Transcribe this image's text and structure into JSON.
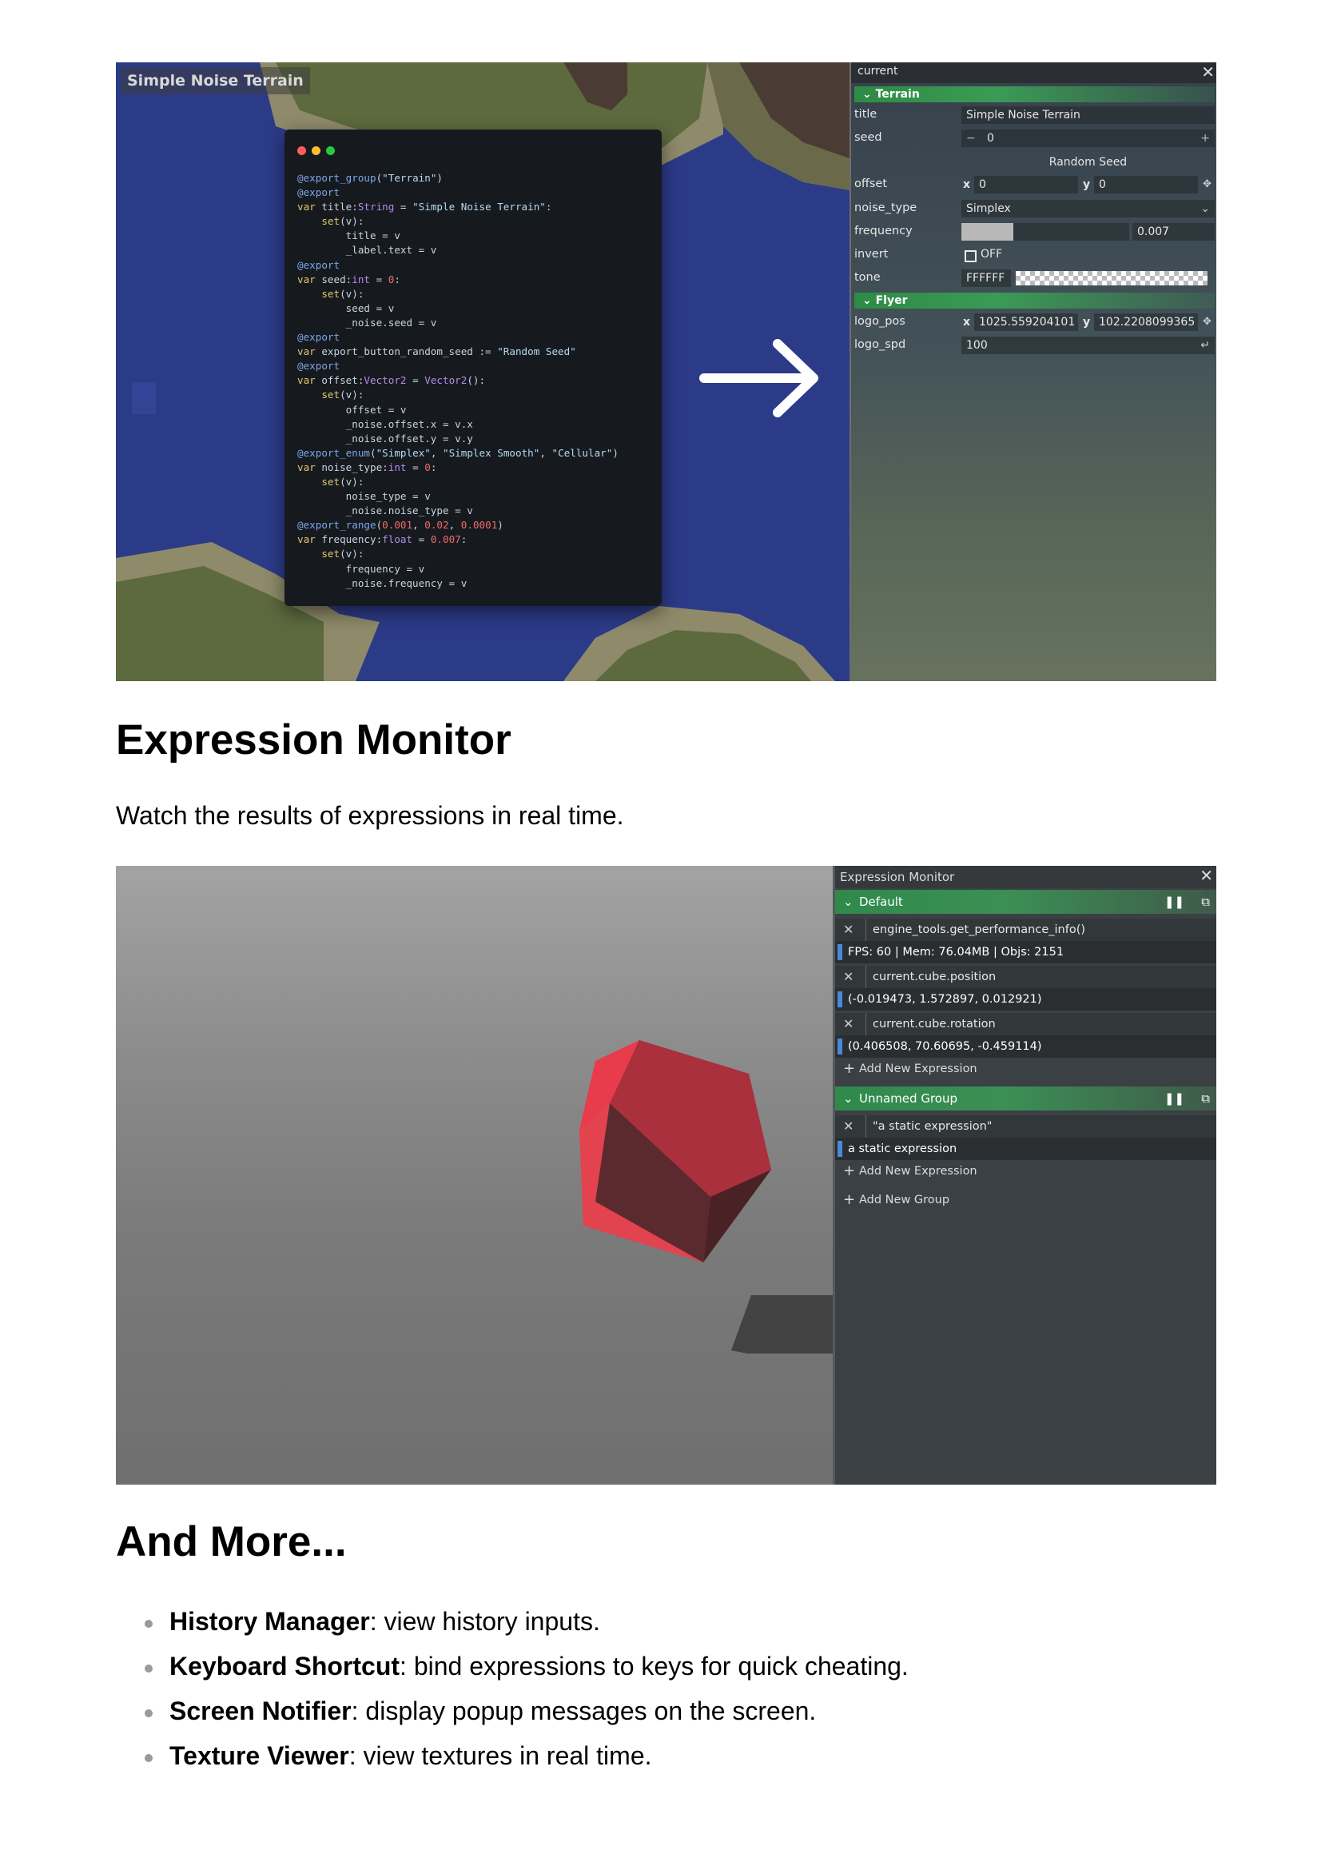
{
  "screenshot1": {
    "game_title": "Simple Noise Terrain",
    "code_lines": [
      "@export_group(\"Terrain\")",
      "@export",
      "var title:String = \"Simple Noise Terrain\":",
      "    set(v):",
      "        title = v",
      "        _label.text = v",
      "@export",
      "var seed:int = 0:",
      "    set(v):",
      "        seed = v",
      "        _noise.seed = v",
      "@export",
      "var export_button_random_seed := \"Random Seed\"",
      "@export",
      "var offset:Vector2 = Vector2():",
      "    set(v):",
      "        offset = v",
      "        _noise.offset.x = v.x",
      "        _noise.offset.y = v.y",
      "@export_enum(\"Simplex\", \"Simplex Smooth\", \"Cellular\")",
      "var noise_type:int = 0:",
      "    set(v):",
      "        noise_type = v",
      "        _noise.noise_type = v",
      "@export_range(0.001, 0.02, 0.0001)",
      "var frequency:float = 0.007:",
      "    set(v):",
      "        frequency = v",
      "        _noise.frequency = v"
    ],
    "inspector": {
      "header": "current",
      "terrain_group": "Terrain",
      "title_label": "title",
      "title_value": "Simple Noise Terrain",
      "seed_label": "seed",
      "seed_value": "0",
      "random_seed_button": "Random Seed",
      "offset_label": "offset",
      "offset_x_label": "x",
      "offset_x": "0",
      "offset_y_label": "y",
      "offset_y": "0",
      "noise_type_label": "noise_type",
      "noise_type_value": "Simplex",
      "frequency_label": "frequency",
      "frequency_value": "0.007",
      "frequency_fraction": 0.31,
      "invert_label": "invert",
      "invert_value": "OFF",
      "tone_label": "tone",
      "tone_value": "FFFFFF",
      "flyer_group": "Flyer",
      "logo_pos_label": "logo_pos",
      "logo_pos_x_label": "x",
      "logo_pos_x": "1025.559204101",
      "logo_pos_y_label": "y",
      "logo_pos_y": "102.2208099365",
      "logo_spd_label": "logo_spd",
      "logo_spd_value": "100"
    }
  },
  "section_expression": {
    "heading": "Expression Monitor",
    "description": "Watch the results of expressions in real time."
  },
  "screenshot2": {
    "panel_title": "Expression Monitor",
    "groups": [
      {
        "name": "Default",
        "expressions": [
          {
            "expr": "engine_tools.get_performance_info()",
            "result": "FPS: 60 | Mem: 76.04MB | Objs: 2151"
          },
          {
            "expr": "current.cube.position",
            "result": "(-0.019473, 1.572897, 0.012921)"
          },
          {
            "expr": "current.cube.rotation",
            "result": "(0.406508, 70.60695, -0.459114)"
          }
        ],
        "add_label": "Add New Expression"
      },
      {
        "name": "Unnamed Group",
        "expressions": [
          {
            "expr": "\"a static expression\"",
            "result": "a static expression"
          }
        ],
        "add_label": "Add New Expression"
      }
    ],
    "add_group_label": "Add New Group"
  },
  "section_more": {
    "heading": "And More...",
    "items": [
      {
        "title": "History Manager",
        "text": ": view history inputs."
      },
      {
        "title": "Keyboard Shortcut",
        "text": ": bind expressions to keys for quick cheating."
      },
      {
        "title": "Screen Notifier",
        "text": ": display popup messages on the screen."
      },
      {
        "title": "Texture Viewer",
        "text": ": view textures in real time."
      }
    ]
  },
  "colors": {
    "water": "#2c3b88",
    "sand": "#8f8a6a",
    "grass": "#5d6a3e",
    "mountain": "#4a3c34",
    "accent_green": "#2f8a4a",
    "result_bar": "#4a88d8",
    "cube_red": "#e83b4c"
  }
}
